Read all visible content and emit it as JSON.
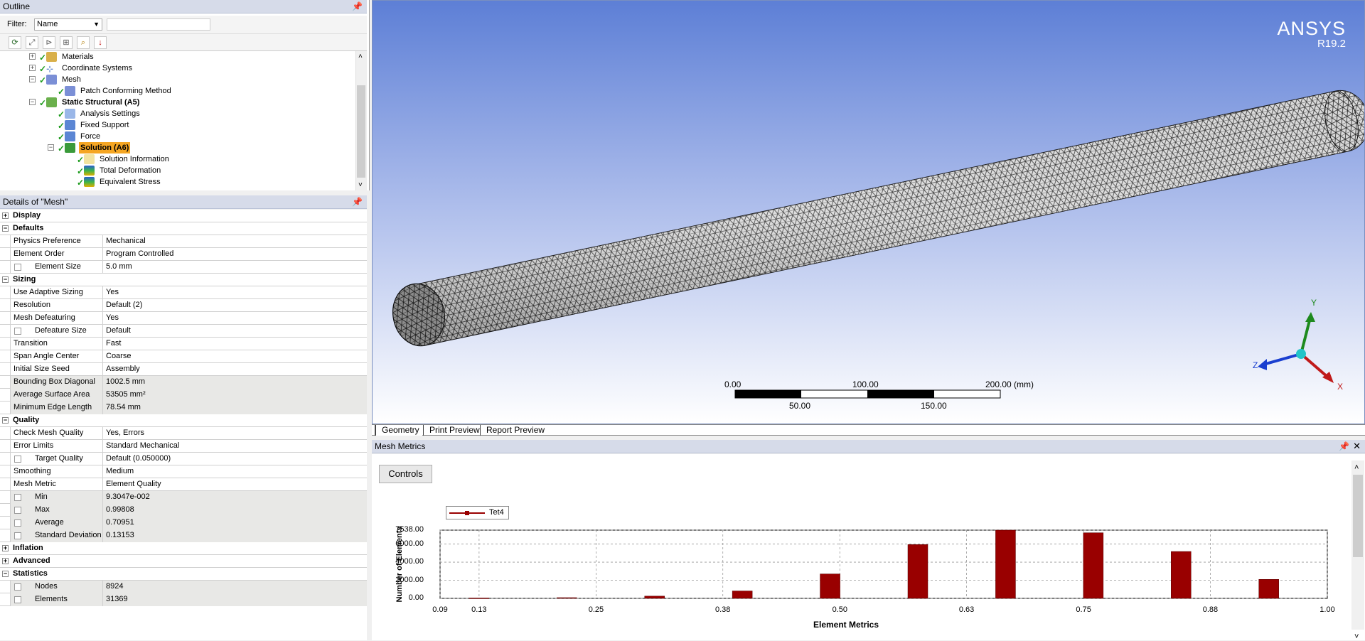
{
  "outline": {
    "title": "Outline",
    "filter_label": "Filter:",
    "filter_value": "Name",
    "filter_text": "",
    "tree": [
      {
        "label": "Materials",
        "icon": "materials-icon",
        "expander": "+"
      },
      {
        "label": "Coordinate Systems",
        "icon": "coordinate-systems-icon",
        "expander": "+"
      },
      {
        "label": "Mesh",
        "icon": "mesh-icon",
        "expander": "−"
      },
      {
        "label": "Patch Conforming Method",
        "icon": "mesh-method-icon"
      },
      {
        "label": "Static Structural (A5)",
        "icon": "static-structural-icon",
        "expander": "−"
      },
      {
        "label": "Analysis Settings",
        "icon": "analysis-settings-icon"
      },
      {
        "label": "Fixed Support",
        "icon": "fixed-support-icon"
      },
      {
        "label": "Force",
        "icon": "force-icon"
      },
      {
        "label": "Solution (A6)",
        "icon": "solution-icon",
        "expander": "−"
      },
      {
        "label": "Solution Information",
        "icon": "solution-information-icon"
      },
      {
        "label": "Total Deformation",
        "icon": "total-deformation-icon"
      },
      {
        "label": "Equivalent Stress",
        "icon": "equivalent-stress-icon"
      }
    ]
  },
  "details": {
    "title": "Details of \"Mesh\"",
    "rows": [
      {
        "type": "cat",
        "label": "Display",
        "exp": "+"
      },
      {
        "type": "cat",
        "label": "Defaults",
        "exp": "−"
      },
      {
        "key": "Physics Preference",
        "value": "Mechanical"
      },
      {
        "key": "Element Order",
        "value": "Program Controlled"
      },
      {
        "key": "Element Size",
        "value": "5.0 mm",
        "box": true
      },
      {
        "type": "cat",
        "label": "Sizing",
        "exp": "−"
      },
      {
        "key": "Use Adaptive Sizing",
        "value": "Yes"
      },
      {
        "key": "Resolution",
        "value": "Default (2)"
      },
      {
        "key": "Mesh Defeaturing",
        "value": "Yes"
      },
      {
        "key": "Defeature Size",
        "value": "Default",
        "box": true
      },
      {
        "key": "Transition",
        "value": "Fast"
      },
      {
        "key": "Span Angle Center",
        "value": "Coarse"
      },
      {
        "key": "Initial Size Seed",
        "value": "Assembly"
      },
      {
        "key": "Bounding Box Diagonal",
        "value": "1002.5 mm",
        "ro": true
      },
      {
        "key": "Average Surface Area",
        "value": "53505 mm²",
        "ro": true
      },
      {
        "key": "Minimum Edge Length",
        "value": "78.54 mm",
        "ro": true
      },
      {
        "type": "cat",
        "label": "Quality",
        "exp": "−"
      },
      {
        "key": "Check Mesh Quality",
        "value": "Yes, Errors"
      },
      {
        "key": "Error Limits",
        "value": "Standard Mechanical"
      },
      {
        "key": "Target Quality",
        "value": "Default (0.050000)",
        "box": true
      },
      {
        "key": "Smoothing",
        "value": "Medium"
      },
      {
        "key": "Mesh Metric",
        "value": "Element Quality"
      },
      {
        "key": "Min",
        "value": "9.3047e-002",
        "box": true,
        "ro": true
      },
      {
        "key": "Max",
        "value": "0.99808",
        "box": true,
        "ro": true
      },
      {
        "key": "Average",
        "value": "0.70951",
        "box": true,
        "ro": true
      },
      {
        "key": "Standard Deviation",
        "value": "0.13153",
        "box": true,
        "ro": true
      },
      {
        "type": "cat",
        "label": "Inflation",
        "exp": "+"
      },
      {
        "type": "cat",
        "label": "Advanced",
        "exp": "+"
      },
      {
        "type": "cat",
        "label": "Statistics",
        "exp": "−"
      },
      {
        "key": "Nodes",
        "value": "8924",
        "box": true,
        "ro": true
      },
      {
        "key": "Elements",
        "value": "31369",
        "box": true,
        "ro": true
      }
    ]
  },
  "viewport": {
    "brand": "ANSYS",
    "version": "R19.2",
    "scale_top": [
      "0.00",
      "100.00",
      "200.00 (mm)"
    ],
    "scale_bottom": [
      "50.00",
      "150.00"
    ],
    "axes": {
      "y": "Y",
      "z": "Z",
      "x": "X"
    },
    "tabs": [
      "Geometry",
      "Print Preview",
      "Report Preview"
    ]
  },
  "mesh_metrics": {
    "title": "Mesh Metrics",
    "controls_label": "Controls",
    "colors": {
      "bar": "#990000"
    }
  },
  "chart_data": {
    "type": "bar",
    "xlabel": "Element Metrics",
    "ylabel": "Number of Elements",
    "legend": [
      "Tet4"
    ],
    "x_ticks": [
      "0.09",
      "0.13",
      "0.25",
      "0.38",
      "0.50",
      "0.63",
      "0.75",
      "0.88",
      "1.00"
    ],
    "y_ticks": [
      "7538.00",
      "6000.00",
      "4000.00",
      "2000.00",
      "0.00"
    ],
    "xlim": [
      0.09,
      1.0
    ],
    "ylim": [
      0,
      7538
    ],
    "series": [
      {
        "name": "Tet4",
        "x": [
          0.13,
          0.22,
          0.31,
          0.4,
          0.49,
          0.58,
          0.67,
          0.76,
          0.85,
          0.94
        ],
        "values": [
          40,
          80,
          250,
          820,
          2700,
          5950,
          7538,
          7250,
          5180,
          2100
        ]
      }
    ]
  }
}
